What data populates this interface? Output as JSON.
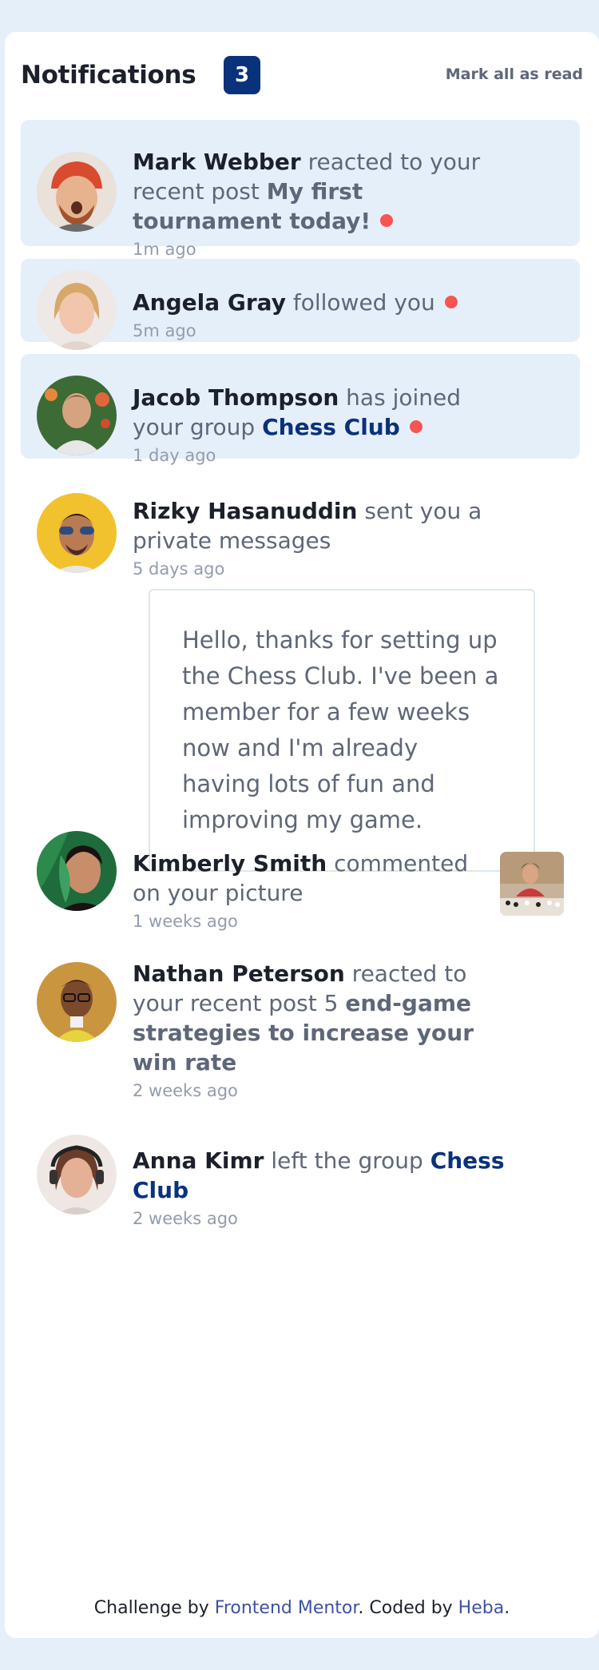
{
  "header": {
    "title": "Notifications",
    "unread_count": "3",
    "mark_all_label": "Mark all as read"
  },
  "notifications": [
    {
      "name": "Mark Webber",
      "action": "reacted to your recent post",
      "post": "My first tournament today!",
      "time": "1m ago",
      "unread": true
    },
    {
      "name": "Angela Gray",
      "action": "followed you",
      "time": "5m ago",
      "unread": true
    },
    {
      "name": "Jacob Thompson",
      "action": "has joined your group",
      "group": "Chess Club",
      "time": "1 day ago",
      "unread": true
    },
    {
      "name": "Rizky Hasanuddin",
      "action": "sent you a private messages",
      "time": "5 days ago",
      "message": "Hello, thanks for setting up the Chess Club. I've been a member for a few weeks now and I'm already having lots of fun and improving my game.",
      "unread": false
    },
    {
      "name": "Kimberly Smith",
      "action": "commented on your picture",
      "time": "1 weeks ago",
      "unread": false
    },
    {
      "name": "Nathan Peterson",
      "action": "reacted to your recent post 5",
      "post": "end-game strategies to increase your win rate",
      "time": "2 weeks ago",
      "unread": false
    },
    {
      "name": "Anna Kimr",
      "action": "left the group",
      "group": "Chess Club",
      "time": "2 weeks ago",
      "unread": false
    }
  ],
  "footer": {
    "prefix": "Challenge by",
    "link1": "Frontend Mentor",
    "middle": ". Coded by",
    "link2": "Heba",
    "suffix": "."
  },
  "colors": {
    "page_bg": "#e5effa",
    "card_bg": "#ffffff",
    "badge_bg": "#0a327b",
    "unread_dot": "#f65552",
    "dark_text": "#1c202b",
    "muted_text": "#5e6778",
    "time_text": "#939cad"
  },
  "icons": {
    "avatars": [
      "avatar-mark-webber",
      "avatar-angela-gray",
      "avatar-jacob-thompson",
      "avatar-rizky-hasanuddin",
      "avatar-kimberly-smith",
      "avatar-nathan-peterson",
      "avatar-anna-kimr"
    ],
    "comment_picture": "chess-picture-thumbnail"
  }
}
